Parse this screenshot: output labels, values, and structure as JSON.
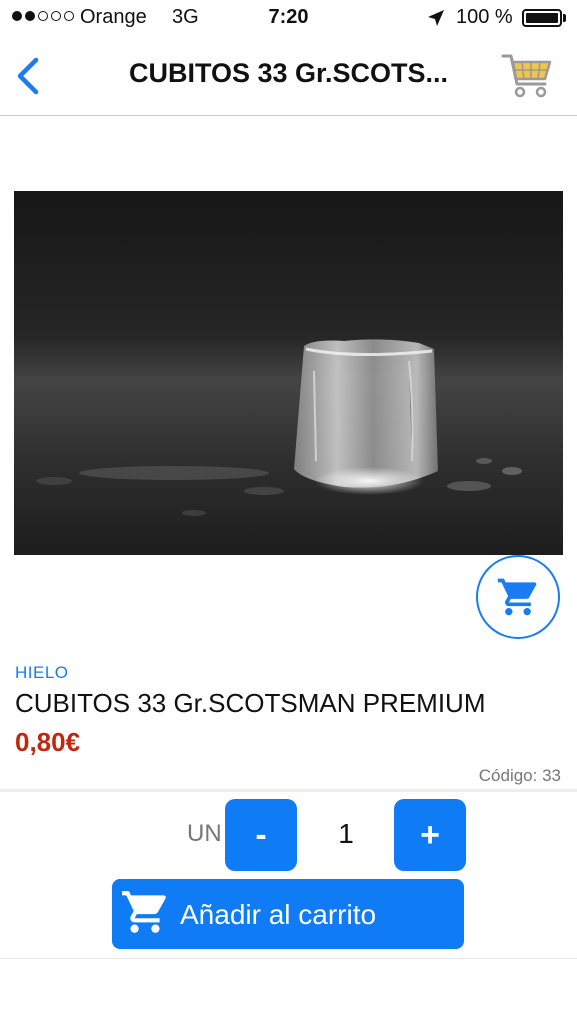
{
  "status_bar": {
    "carrier": "Orange",
    "network": "3G",
    "time": "7:20",
    "battery": "100 %",
    "signal_bars_filled": 2,
    "signal_bars_total": 5
  },
  "nav": {
    "title": "CUBITOS 33 Gr.SCOTS...",
    "back_icon": "chevron-left-icon",
    "cart_icon": "shopping-cart-icon"
  },
  "product": {
    "image": "ice-cube-photo",
    "category": "HIELO",
    "name": "CUBITOS 33 Gr.SCOTSMAN PREMIUM",
    "price": "0,80€",
    "code": "Código: 33"
  },
  "quantity": {
    "unit": "UN",
    "minus_label": "-",
    "value": "1",
    "plus_label": "+"
  },
  "add_to_cart": {
    "label": "Añadir al carrito"
  },
  "colors": {
    "accent": "#0f7cf6",
    "price": "#c0270f"
  }
}
